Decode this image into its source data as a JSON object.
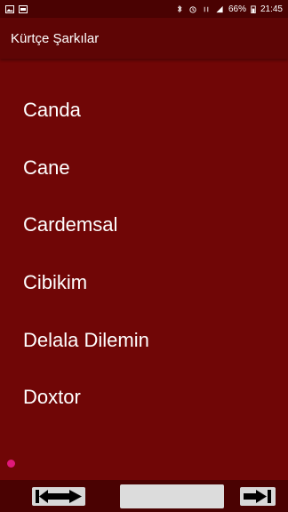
{
  "status_bar": {
    "battery": "66%",
    "time": "21:45"
  },
  "app": {
    "title": "Kürtçe Şarkılar"
  },
  "songs": [
    {
      "label": "Canda"
    },
    {
      "label": "Cane"
    },
    {
      "label": "Cardemsal"
    },
    {
      "label": "Cibikim"
    },
    {
      "label": "Delala Dilemin"
    },
    {
      "label": "Doxtor"
    }
  ],
  "colors": {
    "background": "#700606",
    "app_bar": "#5e0505",
    "status_bar": "#4a0202",
    "accent_dot": "#e0197a"
  },
  "icons": {
    "prev": "skip-previous-icon",
    "next": "skip-next-icon"
  }
}
